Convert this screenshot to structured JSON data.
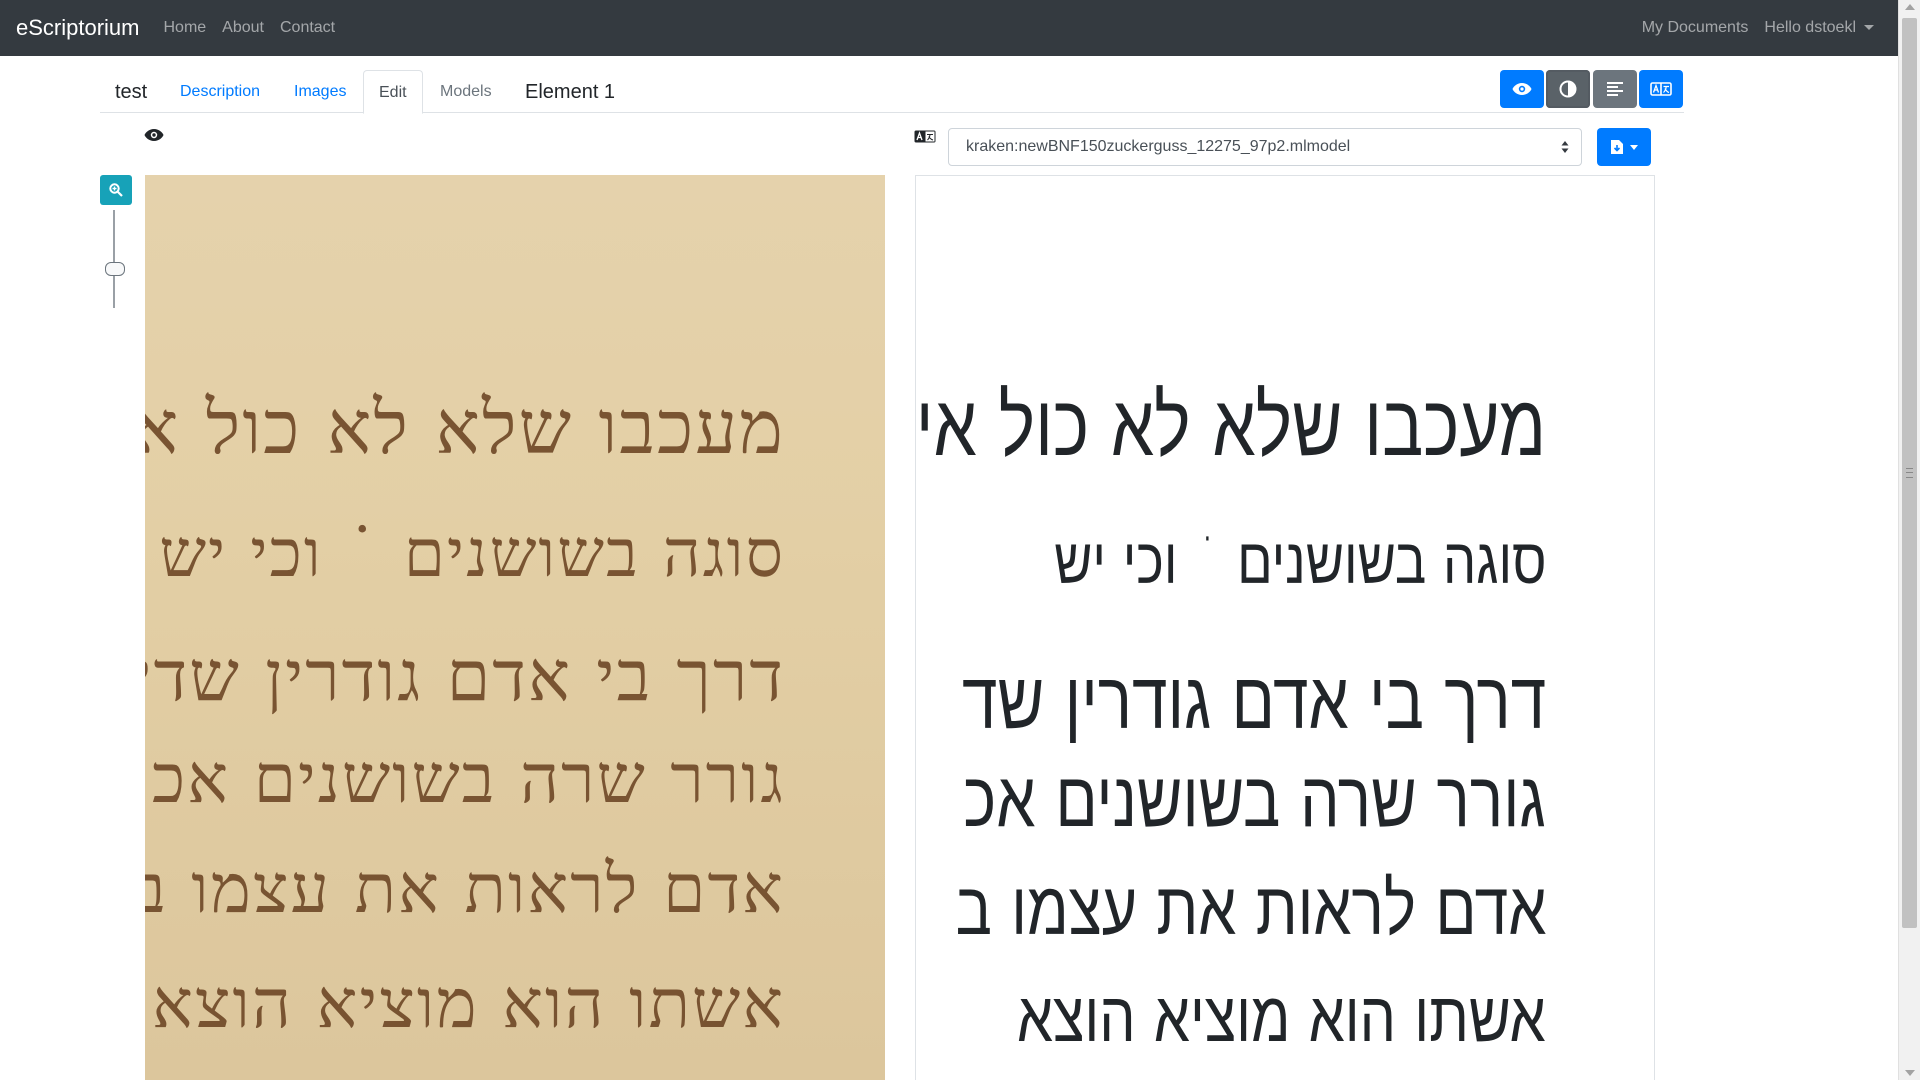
{
  "navbar": {
    "brand": "eScriptorium",
    "links": [
      "Home",
      "About",
      "Contact"
    ],
    "my_documents": "My Documents",
    "user_menu": "Hello dstoekl"
  },
  "tabs": {
    "document_title": "test",
    "description": "Description",
    "images": "Images",
    "edit": "Edit",
    "models": "Models",
    "element": "Element 1"
  },
  "toolbar": {
    "buttons": [
      "eye-icon",
      "contrast-icon",
      "align-icon",
      "translate-icon"
    ]
  },
  "transcription": {
    "model": "kraken:newBNF150zuckerguss_12275_97p2.mlmodel",
    "lines": [
      "מעכבו שלא לא כול אי ז",
      "סוגה בשושנים ˙ וכי יש",
      "דרך בי אדם גודרין שד",
      "גורר שרה בשושנים אכ",
      "אדם לראות את עצמו ב",
      "אשתו הוא מוציא הוצא"
    ]
  },
  "manuscript": {
    "lines": [
      "מעכבו שלא לא כול אי זק",
      "סוגה בשושנים ˙ וכי יש",
      "דרך בי אדם גודרין שדי",
      "גורר שרה בשושנים אכ",
      "אדם לראות את עצמו ב",
      "אשתו הוא מוציא הוצא"
    ]
  },
  "colors": {
    "navbar": "#343a40",
    "primary": "#007bff",
    "secondary": "#6c757d",
    "info": "#17a2b8",
    "ink": "#6b4423",
    "parchment": "#e3cfa5"
  }
}
